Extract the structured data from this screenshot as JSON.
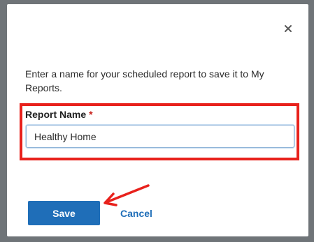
{
  "dialog": {
    "close_icon": "close-icon",
    "message": "Enter a name for your scheduled report to save it to My Reports.",
    "field": {
      "label": "Report Name",
      "required_marker": "*",
      "value": "Healthy Home"
    },
    "buttons": {
      "save_label": "Save",
      "cancel_label": "Cancel"
    }
  },
  "colors": {
    "primary": "#1f6eb8",
    "highlight": "#e8211c",
    "required": "#c8201a",
    "overlay": "#6f7478"
  }
}
